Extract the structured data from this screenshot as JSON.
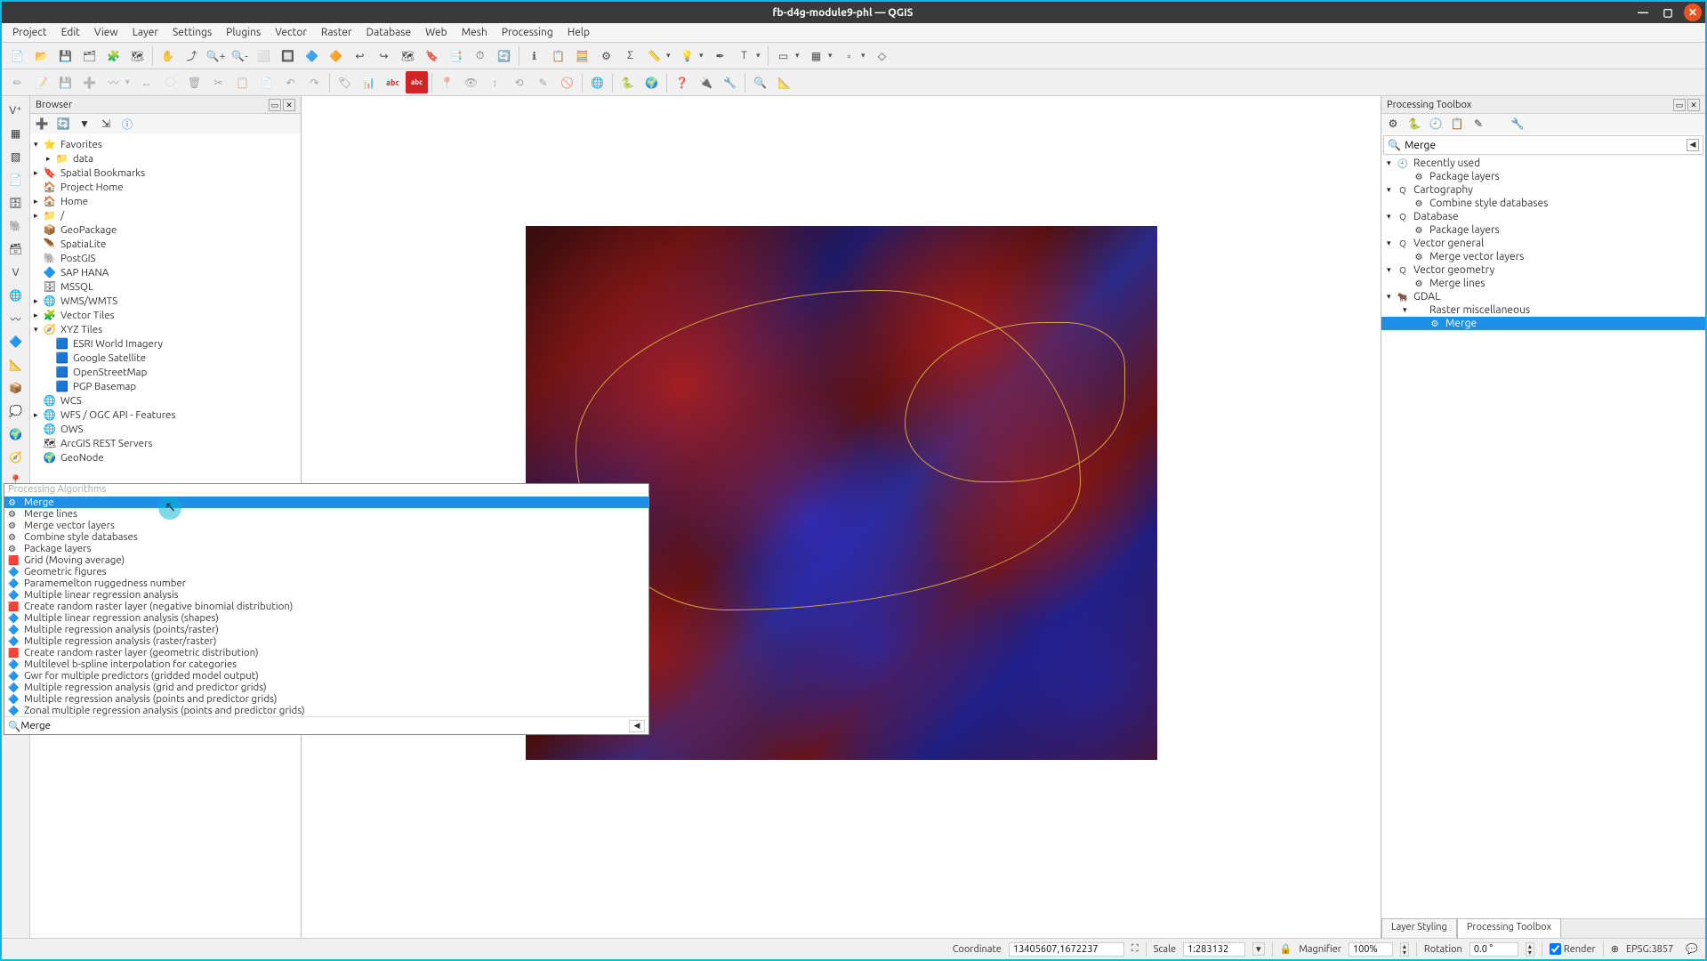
{
  "window": {
    "title": "fb-d4g-module9-phl — QGIS"
  },
  "menubar": [
    "Project",
    "Edit",
    "View",
    "Layer",
    "Settings",
    "Plugins",
    "Vector",
    "Raster",
    "Database",
    "Web",
    "Mesh",
    "Processing",
    "Help"
  ],
  "browser": {
    "title": "Browser",
    "items": [
      {
        "level": 0,
        "arrow": "▾",
        "icon": "⭐",
        "label": "Favorites"
      },
      {
        "level": 1,
        "arrow": "▸",
        "icon": "📁",
        "label": "data"
      },
      {
        "level": 0,
        "arrow": "▸",
        "icon": "🔖",
        "label": "Spatial Bookmarks"
      },
      {
        "level": 0,
        "arrow": "",
        "icon": "🏠",
        "label": "Project Home"
      },
      {
        "level": 0,
        "arrow": "▸",
        "icon": "🏠",
        "label": "Home"
      },
      {
        "level": 0,
        "arrow": "▸",
        "icon": "📁",
        "label": "/"
      },
      {
        "level": 0,
        "arrow": "",
        "icon": "📦",
        "label": "GeoPackage"
      },
      {
        "level": 0,
        "arrow": "",
        "icon": "🪶",
        "label": "SpatiaLite"
      },
      {
        "level": 0,
        "arrow": "",
        "icon": "🐘",
        "label": "PostGIS"
      },
      {
        "level": 0,
        "arrow": "",
        "icon": "🔷",
        "label": "SAP HANA"
      },
      {
        "level": 0,
        "arrow": "",
        "icon": "🗄",
        "label": "MSSQL"
      },
      {
        "level": 0,
        "arrow": "▸",
        "icon": "🌐",
        "label": "WMS/WMTS"
      },
      {
        "level": 0,
        "arrow": "▸",
        "icon": "🧩",
        "label": "Vector Tiles"
      },
      {
        "level": 0,
        "arrow": "▾",
        "icon": "🧭",
        "label": "XYZ Tiles"
      },
      {
        "level": 1,
        "arrow": "",
        "icon": "🟦",
        "label": "ESRI World Imagery"
      },
      {
        "level": 1,
        "arrow": "",
        "icon": "🟦",
        "label": "Google Satellite"
      },
      {
        "level": 1,
        "arrow": "",
        "icon": "🟦",
        "label": "OpenStreetMap"
      },
      {
        "level": 1,
        "arrow": "",
        "icon": "🟦",
        "label": "PGP Basemap"
      },
      {
        "level": 0,
        "arrow": "",
        "icon": "🌐",
        "label": "WCS"
      },
      {
        "level": 0,
        "arrow": "▸",
        "icon": "🌐",
        "label": "WFS / OGC API - Features"
      },
      {
        "level": 0,
        "arrow": "",
        "icon": "🌐",
        "label": "OWS"
      },
      {
        "level": 0,
        "arrow": "",
        "icon": "🗺",
        "label": "ArcGIS REST Servers"
      },
      {
        "level": 0,
        "arrow": "",
        "icon": "🌍",
        "label": "GeoNode"
      }
    ]
  },
  "toolbox": {
    "title": "Processing Toolbox",
    "search_value": "Merge",
    "tree": [
      {
        "level": 0,
        "arrow": "▾",
        "icon": "🕘",
        "label": "Recently used"
      },
      {
        "level": 1,
        "arrow": "",
        "icon": "⚙",
        "label": "Package layers"
      },
      {
        "level": 0,
        "arrow": "▾",
        "icon": "Q",
        "label": "Cartography"
      },
      {
        "level": 1,
        "arrow": "",
        "icon": "⚙",
        "label": "Combine style databases"
      },
      {
        "level": 0,
        "arrow": "▾",
        "icon": "Q",
        "label": "Database"
      },
      {
        "level": 1,
        "arrow": "",
        "icon": "⚙",
        "label": "Package layers"
      },
      {
        "level": 0,
        "arrow": "▾",
        "icon": "Q",
        "label": "Vector general"
      },
      {
        "level": 1,
        "arrow": "",
        "icon": "⚙",
        "label": "Merge vector layers"
      },
      {
        "level": 0,
        "arrow": "▾",
        "icon": "Q",
        "label": "Vector geometry"
      },
      {
        "level": 1,
        "arrow": "",
        "icon": "⚙",
        "label": "Merge lines"
      },
      {
        "level": 0,
        "arrow": "▾",
        "icon": "🐂",
        "label": "GDAL"
      },
      {
        "level": 1,
        "arrow": "▾",
        "icon": "",
        "label": "Raster miscellaneous"
      },
      {
        "level": 2,
        "arrow": "",
        "icon": "⚙",
        "label": "Merge",
        "selected": true
      }
    ],
    "tabs": [
      "Layer Styling",
      "Processing Toolbox"
    ],
    "active_tab": 1
  },
  "popup": {
    "header": "Processing Algorithms",
    "items": [
      {
        "icon": "⚙",
        "label": "Merge",
        "selected": true
      },
      {
        "icon": "⚙",
        "label": "Merge lines"
      },
      {
        "icon": "⚙",
        "label": "Merge vector layers"
      },
      {
        "icon": "⚙",
        "label": "Combine style databases"
      },
      {
        "icon": "⚙",
        "label": "Package layers"
      },
      {
        "icon": "🟥",
        "label": "Grid (Moving average)"
      },
      {
        "icon": "🔷",
        "label": "Geometric figures"
      },
      {
        "icon": "🔷",
        "label": "Paramemelton ruggedness number"
      },
      {
        "icon": "🔷",
        "label": "Multiple linear regression analysis"
      },
      {
        "icon": "🟥",
        "label": "Create random raster layer (negative binomial distribution)"
      },
      {
        "icon": "🔷",
        "label": "Multiple linear regression analysis (shapes)"
      },
      {
        "icon": "🔷",
        "label": "Multiple regression analysis (points/raster)"
      },
      {
        "icon": "🔷",
        "label": "Multiple regression analysis (raster/raster)"
      },
      {
        "icon": "🟥",
        "label": "Create random raster layer (geometric distribution)"
      },
      {
        "icon": "🔷",
        "label": "Multilevel b-spline interpolation for categories"
      },
      {
        "icon": "🔷",
        "label": "Gwr for multiple predictors (gridded model output)"
      },
      {
        "icon": "🔷",
        "label": "Multiple regression analysis (grid and predictor grids)"
      },
      {
        "icon": "🔷",
        "label": "Multiple regression analysis (points and predictor grids)"
      },
      {
        "icon": "🔷",
        "label": "Zonal multiple regression analysis (points and predictor grids)"
      }
    ],
    "search_value": "Merge"
  },
  "statusbar": {
    "coord_label": "Coordinate",
    "coord_value": "13405607,1672237",
    "scale_label": "Scale",
    "scale_value": "1:283132",
    "magnifier_label": "Magnifier",
    "magnifier_value": "100%",
    "rotation_label": "Rotation",
    "rotation_value": "0.0 °",
    "render_label": "Render",
    "crs": "EPSG:3857"
  }
}
